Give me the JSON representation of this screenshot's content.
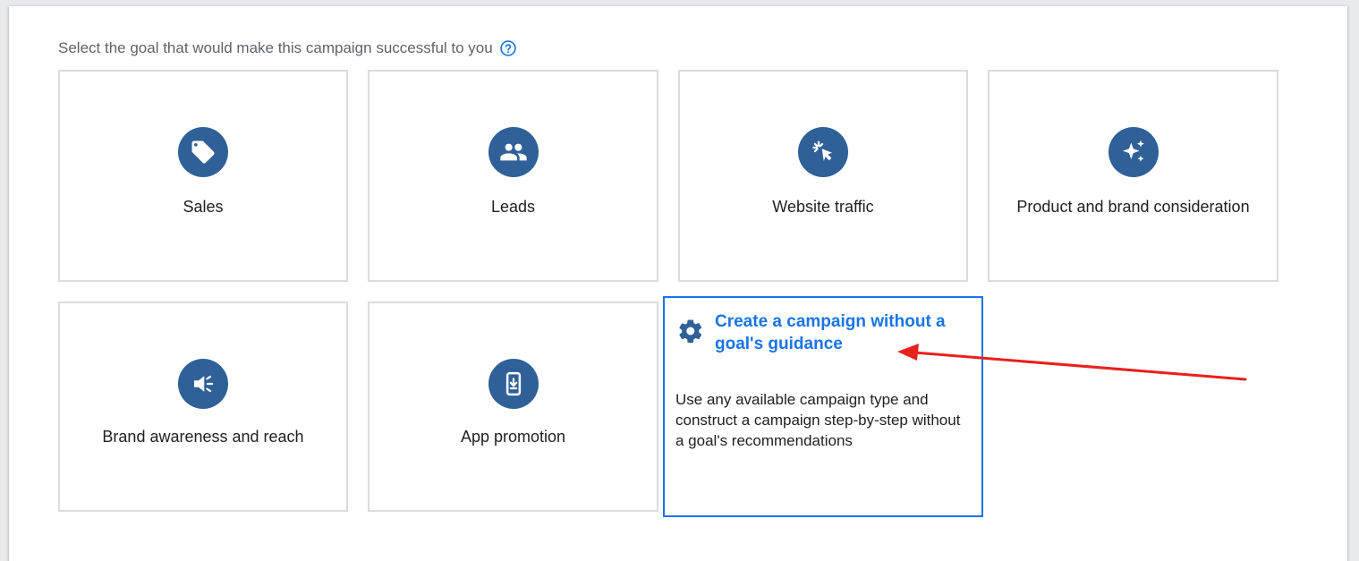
{
  "header": {
    "prompt": "Select the goal that would make this campaign successful to you",
    "help_icon": "help-circle-icon"
  },
  "goals": [
    {
      "label": "Sales",
      "icon": "tag-icon"
    },
    {
      "label": "Leads",
      "icon": "people-icon"
    },
    {
      "label": "Website traffic",
      "icon": "cursor-click-icon"
    },
    {
      "label": "Product and brand consideration",
      "icon": "sparkle-icon"
    },
    {
      "label": "Brand awareness and reach",
      "icon": "megaphone-icon"
    },
    {
      "label": "App promotion",
      "icon": "phone-download-icon"
    }
  ],
  "custom_goal": {
    "title": "Create a campaign without a goal's guidance",
    "description": "Use any available campaign type and construct a campaign step-by-step without a goal's recommendations",
    "icon": "gear-icon"
  },
  "annotation": {
    "type": "arrow",
    "color": "#e8211b"
  },
  "colors": {
    "icon_circle": "#2f6198",
    "selected_border": "#1a73e8",
    "card_border": "#dadce0",
    "text_primary": "#202124",
    "text_secondary": "#5f6368"
  }
}
